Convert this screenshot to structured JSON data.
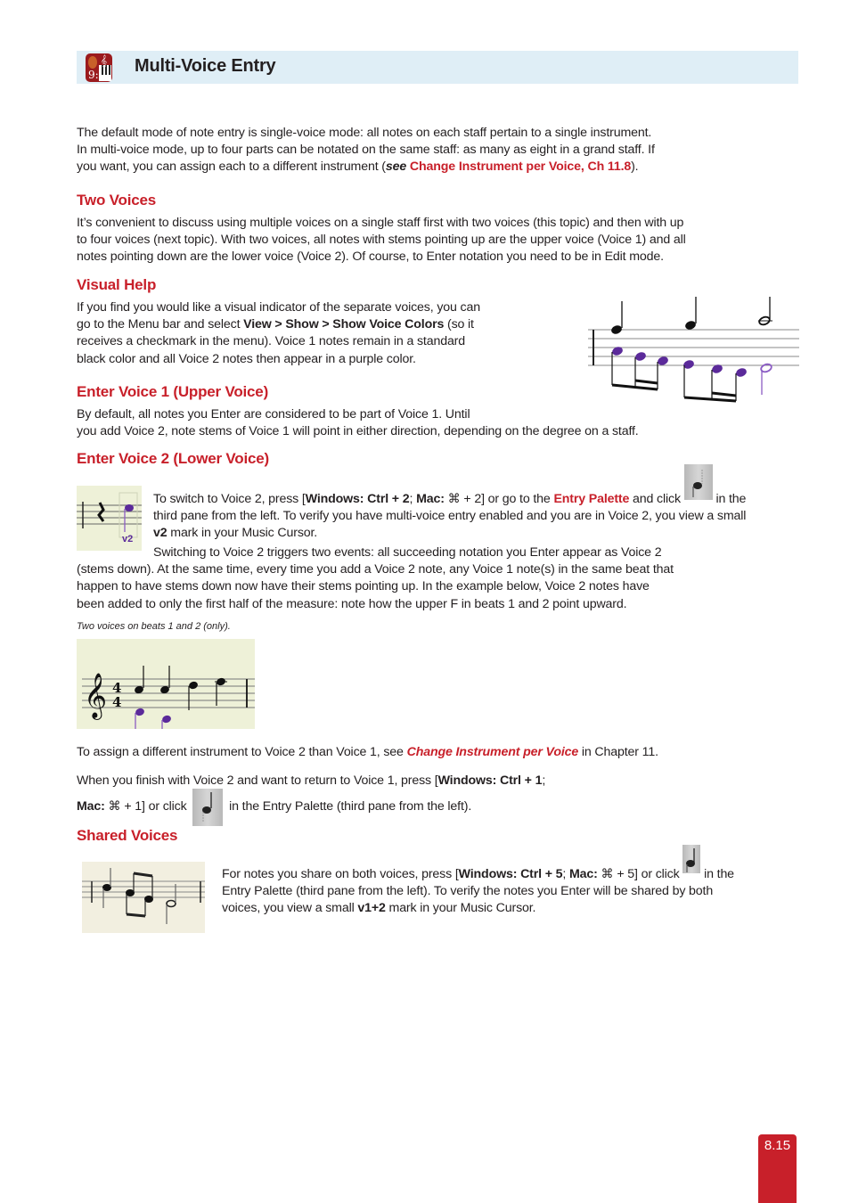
{
  "header": {
    "title": "Multi-Voice Entry",
    "icon": "app-logo-icon",
    "bg_color": "#dfeef6"
  },
  "intro": {
    "line1": "The default mode of note entry is single-voice mode: all notes on each staff pertain to a single instrument.",
    "line2": "In multi-voice mode, up to four parts can be notated on the same staff: as many as eight in a grand staff. If",
    "line3_pre": "you want, you can assign each to a different instrument (",
    "line3_see": "see",
    "line3_link": "Change Instrument per Voice, Ch 11.8",
    "line3_post": ")."
  },
  "two_voices": {
    "heading": "Two Voices",
    "line1": "It’s convenient to discuss using multiple voices on a single staff first with two voices (this topic) and then with up",
    "line2": "to four voices (next topic). With two voices, all notes with stems pointing up are the upper voice (Voice 1) and all",
    "line3": "notes pointing down are the lower voice (Voice 2). Of course, to Enter notation you need to be in Edit mode."
  },
  "visual_help": {
    "heading": "Visual Help",
    "line1": "If you find you would like a visual indicator of the separate voices, you can",
    "line2_pre": "go to the Menu bar and select ",
    "line2_bold": "View > Show > Show Voice Colors",
    "line2_post": " (so it",
    "line3": "receives a checkmark in the menu). Voice 1 notes remain in a standard",
    "line4": "black color and all Voice 2 notes then appear in a purple color.",
    "figure": "voice-colors-example"
  },
  "enter_voice1": {
    "heading": "Enter Voice 1 (Upper Voice)",
    "line1": "By default, all notes you Enter are considered to be part of Voice 1. Until",
    "line2": "you add Voice 2, note stems of Voice 1 will point in either direction, depending on the degree on a staff."
  },
  "enter_voice2": {
    "heading": "Enter Voice 2 (Lower Voice)",
    "cursor_mark": "v2",
    "p1_a": "To switch to Voice 2, press [",
    "p1_win": "Windows: Ctrl + 2",
    "p1_sep": "; ",
    "p1_mac": "Mac:",
    "p1_mac_keys": " ⌘ + 2",
    "p1_b": "] or go to the ",
    "p1_link": "Entry Palette",
    "p1_c": " and click ",
    "p1_d": " in the",
    "p1_line2": "third pane from the left. To verify you have multi-voice entry enabled and you are in Voice 2, you view a small",
    "p1_line3_bold": "v2",
    "p1_line3": " mark in your Music Cursor.",
    "p2_line1": "Switching to Voice 2 triggers two events: all succeeding notation you Enter appear as Voice 2",
    "p2_line2": "(stems down). At the same time, every time you add a Voice 2 note, any Voice 1 note(s) in the same beat that",
    "p2_line3": "happen to have stems down now have their stems pointing up. In the example below, Voice 2 notes have",
    "p2_line4": "been added to only the first half of the measure: note how the upper F in beats 1 and 2 point upward.",
    "caption": "Two voices on beats 1 and 2 (only).",
    "assign_pre": "To assign a different instrument to Voice 2 than Voice 1, see ",
    "assign_link": "Change Instrument per Voice",
    "assign_post": " in Chapter 11.",
    "finish_line1_pre": "When you finish with Voice 2 and want to return to Voice 1, press [",
    "finish_win": "Windows: Ctrl + 1",
    "finish_line1_post": ";",
    "finish_mac": "Mac:",
    "finish_mac_keys": " ⌘ + 1",
    "finish_line2_a": "] or click ",
    "finish_line2_b": " in the Entry Palette (third pane from the left)."
  },
  "shared_voices": {
    "heading": "Shared Voices",
    "l1_a": "For notes you share on both voices, press [",
    "l1_win": "Windows: Ctrl + 5",
    "l1_sep": "; ",
    "l1_mac": "Mac:",
    "l1_mac_keys": " ⌘ + 5",
    "l1_b": "] or click ",
    "l1_c": " in the",
    "l2": "Entry Palette (third pane from the left). To verify the notes you Enter will be shared by both",
    "l3_a": "voices, you view a small ",
    "l3_bold": "v1+2",
    "l3_b": " mark in your Music Cursor."
  },
  "footer": {
    "page_number": "8.15",
    "accent": "#c8202a"
  },
  "colors": {
    "heading_red": "#c8202a",
    "voice2_purple": "#5b2a9a",
    "figure_bg": "#eef1d8"
  }
}
